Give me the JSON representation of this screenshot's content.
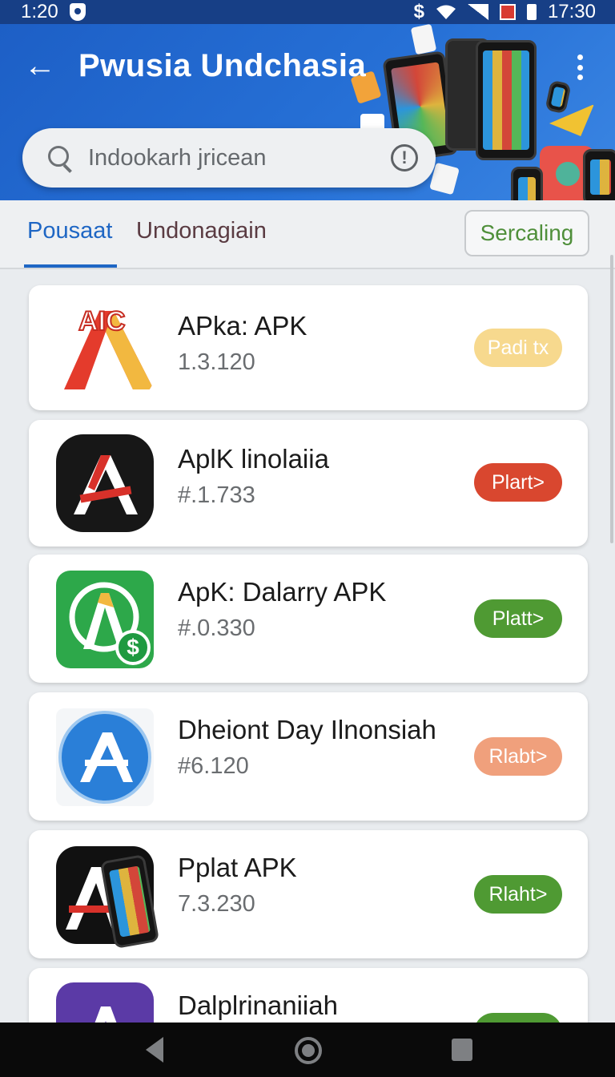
{
  "status_bar": {
    "time_left": "1:20",
    "time_right": "17:30",
    "currency_glyph": "$"
  },
  "app_bar": {
    "title": "Pwusia Undchasia",
    "back_glyph": "←"
  },
  "search": {
    "placeholder": "Indookarh jricean",
    "info_glyph": "!"
  },
  "tabs": {
    "active": "Pousaat",
    "other": "Undonagiain",
    "sort_label": "Sercaling"
  },
  "apps": [
    {
      "name": "APka: APK",
      "version": "1.3.120",
      "action": "Padi tx",
      "action_color": "#f7d98e",
      "action_text_color": "#ffffff",
      "icon": "aic-icon",
      "icon_text": "AIC"
    },
    {
      "name": "AplK linolaiia",
      "version": "#.1.733",
      "action": "Plart>",
      "action_color": "#d9472f",
      "action_text_color": "#ffffff",
      "icon": "dark-a-icon"
    },
    {
      "name": "ApK: Dalarry APK",
      "version": "#.0.330",
      "action": "Platt>",
      "action_color": "#4f9a33",
      "action_text_color": "#ffffff",
      "icon": "green-dollar-icon",
      "icon_badge": "$"
    },
    {
      "name": "Dheiont Day Ilnonsiah",
      "version": "#6.120",
      "action": "Rlabt>",
      "action_color": "#f0a07c",
      "action_text_color": "#ffffff",
      "icon": "blue-a-icon"
    },
    {
      "name": "Pplat APK",
      "version": "7.3.230",
      "action": "Rlaht>",
      "action_color": "#4f9a33",
      "action_text_color": "#ffffff",
      "icon": "phone-a-icon"
    },
    {
      "name": "Dalplrinaniiah",
      "version": "",
      "action": "",
      "action_color": "#4f9a33",
      "action_text_color": "#ffffff",
      "icon": "purple-a-icon"
    }
  ]
}
